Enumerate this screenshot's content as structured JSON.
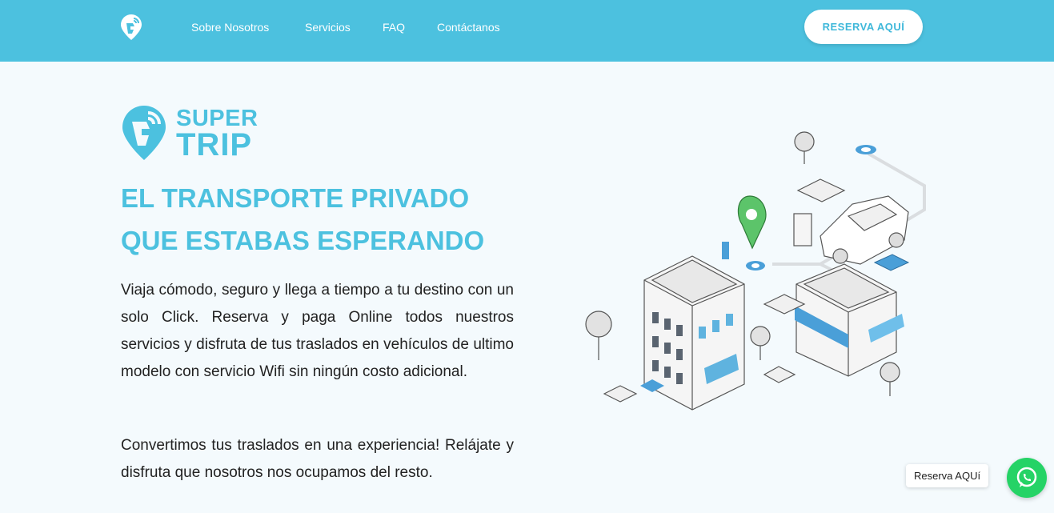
{
  "nav": {
    "links": [
      "Sobre Nosotros",
      "Servicios",
      "FAQ",
      "Contáctanos"
    ],
    "cta_label": "RESERVA AQUÍ",
    "logo_icon": "supertrip-logo-icon"
  },
  "brand": {
    "line1": "SUPER",
    "line2": "TRIP",
    "icon": "supertrip-logo-icon"
  },
  "hero": {
    "headline_line1": "EL TRANSPORTE PRIVADO",
    "headline_line2": "QUE ESTABAS ESPERANDO",
    "paragraph1": "Viaja cómodo, seguro y llega a tiempo a tu destino con un solo Click. Reserva y paga Online todos nuestros servicios y disfruta de tus traslados en vehículos de ultimo modelo con servicio Wifi sin ningún costo adicional.",
    "paragraph2": "Convertimos tus traslados en una experiencia! Relájate y disfruta que nosotros nos ocupamos del resto."
  },
  "whatsapp": {
    "label": "Reserva AQUí",
    "icon": "whatsapp-icon"
  },
  "colors": {
    "primary": "#4cc1df",
    "background": "#f4fafd",
    "text": "#222222",
    "whatsapp": "#25d366",
    "pin": "#5cc46a"
  }
}
